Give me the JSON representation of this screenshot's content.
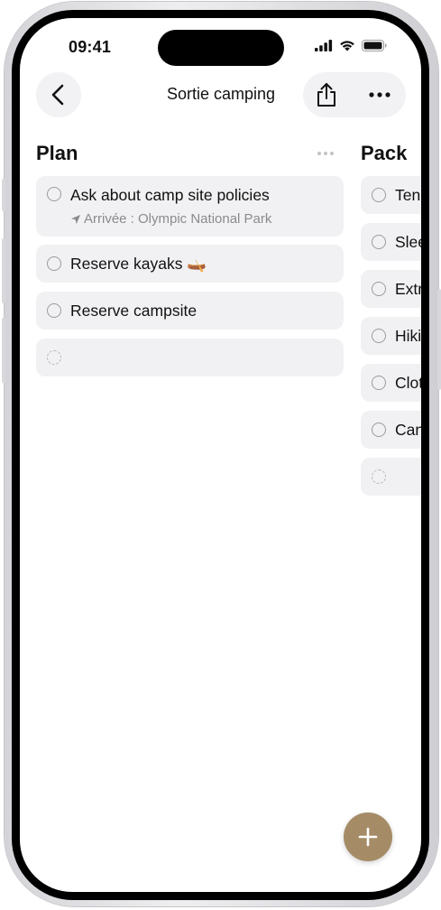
{
  "status_bar": {
    "time": "09:41"
  },
  "header": {
    "title": "Sortie camping"
  },
  "columns": [
    {
      "title": "Plan",
      "tasks": [
        {
          "text": "Ask about camp site policies",
          "subtitle": "Arrivée : Olympic National Park"
        },
        {
          "text": "Reserve kayaks",
          "emoji": "🛶"
        },
        {
          "text": "Reserve campsite"
        }
      ]
    },
    {
      "title": "Pack",
      "tasks": [
        {
          "text": "Ten"
        },
        {
          "text": "Slee"
        },
        {
          "text": "Extr"
        },
        {
          "text": "Hiki"
        },
        {
          "text": "Clot"
        },
        {
          "text": "Can"
        }
      ]
    }
  ],
  "colors": {
    "accent": "#a58c67",
    "card": "#f1f1f3",
    "frame": "#e4e4e7"
  }
}
